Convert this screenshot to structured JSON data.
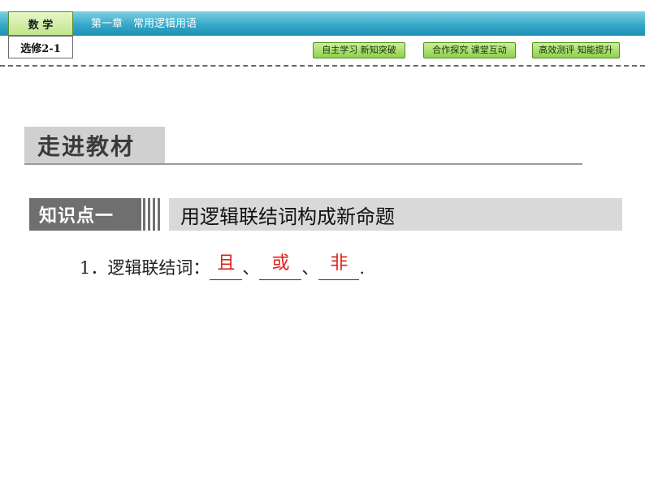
{
  "header": {
    "subject": "数 学",
    "course": "选修2-1",
    "chapter": "第一章　常用逻辑用语",
    "nav_buttons": [
      {
        "label": "自主学习  新知突破"
      },
      {
        "label": "合作探究  课堂互动"
      },
      {
        "label": "高效测评  知能提升"
      }
    ],
    "colors": {
      "bar": "#36a9c9",
      "button": "#8fd04d",
      "answer": "#e0231b"
    }
  },
  "section": {
    "title": "走进教材"
  },
  "knowledge_point": {
    "label": "知识点一",
    "title": "用逻辑联结词构成新命题"
  },
  "content": {
    "number": "1．",
    "prompt": "逻辑联结词：",
    "answers": [
      "且",
      "或",
      "非"
    ],
    "separator": "、",
    "end": "."
  }
}
